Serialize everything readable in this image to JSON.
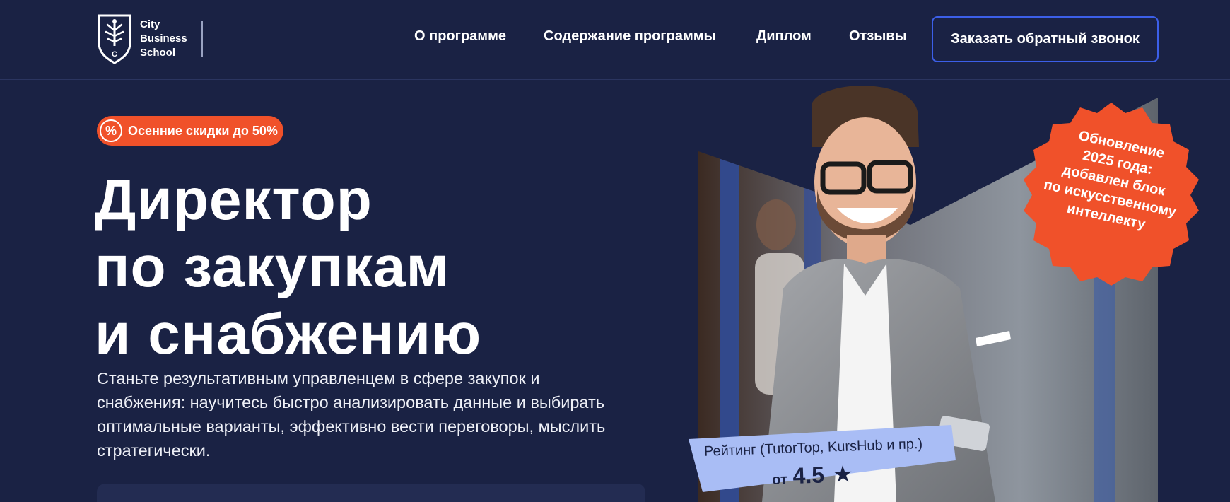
{
  "logo": {
    "line1": "City",
    "line2": "Business",
    "line3": "School",
    "shield_letter": "C"
  },
  "nav": {
    "items": [
      {
        "label": "О программе"
      },
      {
        "label": "Содержание программы"
      },
      {
        "label": "Диплом"
      },
      {
        "label": "Отзывы"
      }
    ],
    "cta_label": "Заказать обратный звонок"
  },
  "hero": {
    "promo_icon": "%",
    "promo_text": "Осенние скидки до 50%",
    "title_lines": [
      "Директор",
      "по закупкам",
      "и снабжению"
    ],
    "description": "Станьте результативным управленцем в сфере закупок и снабжения: научитесь быстро анализировать данные и выбирать оптимальные варианты, эффективно вести переговоры, мыслить стратегически."
  },
  "sticker": {
    "lines": [
      "Обновление",
      "2025 года:",
      "добавлен блок",
      "по искусственному",
      "интеллекту"
    ]
  },
  "rating": {
    "label": "Рейтинг (TutorTop, KursHub и пр.)",
    "from": "от",
    "value": "4.5",
    "star_icon": "★"
  },
  "colors": {
    "background": "#1a2244",
    "accent_orange": "#f0512a",
    "cta_border": "#3c5fe8",
    "rating_bg": "#a9bdf5"
  }
}
